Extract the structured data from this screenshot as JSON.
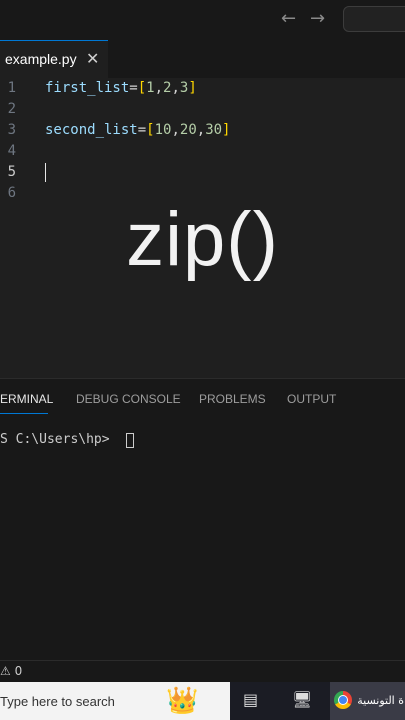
{
  "titlebar": {
    "back_icon": "arrow-left-icon",
    "forward_icon": "arrow-right-icon"
  },
  "editor": {
    "tab": {
      "label": "example.py",
      "close_glyph": "✕"
    },
    "lines": [
      {
        "number": "1",
        "code": "first_list=[1,2,3]"
      },
      {
        "number": "2",
        "code": ""
      },
      {
        "number": "3",
        "code": "second_list=[10,20,30]"
      },
      {
        "number": "4",
        "code": ""
      },
      {
        "number": "5",
        "code": ""
      },
      {
        "number": "6",
        "code": ""
      }
    ],
    "overlay_text": "zip()",
    "colors": {
      "variable": "#9cdcfe",
      "bracket": "#ffd700",
      "number": "#b5cea8",
      "accent": "#0078d4"
    }
  },
  "panel": {
    "tabs": [
      {
        "label": "ERMINAL",
        "active": true
      },
      {
        "label": "DEBUG CONSOLE",
        "active": false
      },
      {
        "label": "PROBLEMS",
        "active": false
      },
      {
        "label": "OUTPUT",
        "active": false
      }
    ],
    "prompt": "S C:\\Users\\hp> "
  },
  "statusbar": {
    "warnings": "⚠ 0"
  },
  "taskbar": {
    "search_placeholder": "Type here to search",
    "chrome_label": "ة التونسية"
  }
}
